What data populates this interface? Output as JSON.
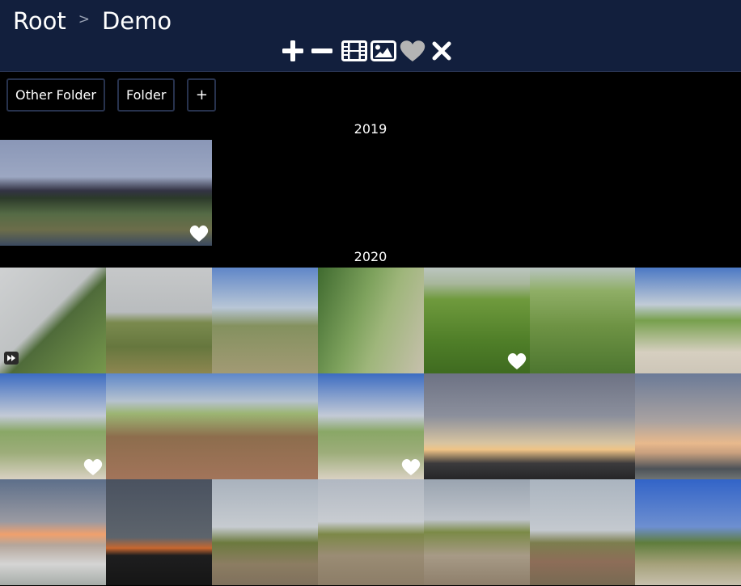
{
  "breadcrumb": {
    "root": "Root",
    "separator": ">",
    "current": "Demo"
  },
  "toolbar": {
    "buttons": [
      {
        "name": "zoom-in",
        "icon": "plus-icon"
      },
      {
        "name": "zoom-out",
        "icon": "minus-icon"
      },
      {
        "name": "filter-videos",
        "icon": "film-icon"
      },
      {
        "name": "filter-images",
        "icon": "image-icon"
      },
      {
        "name": "filter-favorites",
        "icon": "heart-icon"
      },
      {
        "name": "clear-filter",
        "icon": "close-icon"
      }
    ]
  },
  "folders": {
    "items": [
      "Other Folder",
      "Folder"
    ],
    "add_label": "+"
  },
  "years": [
    "2019",
    "2020"
  ],
  "colors": {
    "header_bg": "#121f3d",
    "page_bg": "#000000",
    "button_border": "#27324d",
    "favorite_heart": "#ffffff"
  },
  "photos": {
    "2019": [
      {
        "scene": "industry",
        "favorite": false,
        "video": false
      },
      {
        "scene": "industry",
        "favorite": true,
        "video": false
      }
    ],
    "2020": [
      {
        "scene": "balcony",
        "favorite": false,
        "video": true
      },
      {
        "scene": "marsh",
        "favorite": false,
        "video": false
      },
      {
        "scene": "reeds",
        "favorite": false,
        "video": false
      },
      {
        "scene": "plants",
        "favorite": false,
        "video": false
      },
      {
        "scene": "green1",
        "favorite": true,
        "video": false
      },
      {
        "scene": "green2",
        "favorite": false,
        "video": false
      },
      {
        "scene": "path",
        "favorite": false,
        "video": false
      },
      {
        "scene": "path2",
        "favorite": true,
        "video": false
      },
      {
        "scene": "creek",
        "favorite": false,
        "video": false
      },
      {
        "scene": "creek",
        "favorite": false,
        "video": false
      },
      {
        "scene": "path2",
        "favorite": true,
        "video": false
      },
      {
        "scene": "sunset1",
        "favorite": false,
        "video": false
      },
      {
        "scene": "sunset1",
        "favorite": false,
        "video": false
      },
      {
        "scene": "sunset2",
        "favorite": false,
        "video": false
      },
      {
        "scene": "sea",
        "favorite": false,
        "video": false
      },
      {
        "scene": "dusk",
        "favorite": false,
        "video": false
      },
      {
        "scene": "dune1",
        "favorite": false,
        "video": false
      },
      {
        "scene": "dune2",
        "favorite": false,
        "video": false
      },
      {
        "scene": "dune3",
        "favorite": false,
        "video": false
      },
      {
        "scene": "moor",
        "favorite": false,
        "video": false
      },
      {
        "scene": "blue",
        "favorite": false,
        "video": false
      }
    ]
  }
}
